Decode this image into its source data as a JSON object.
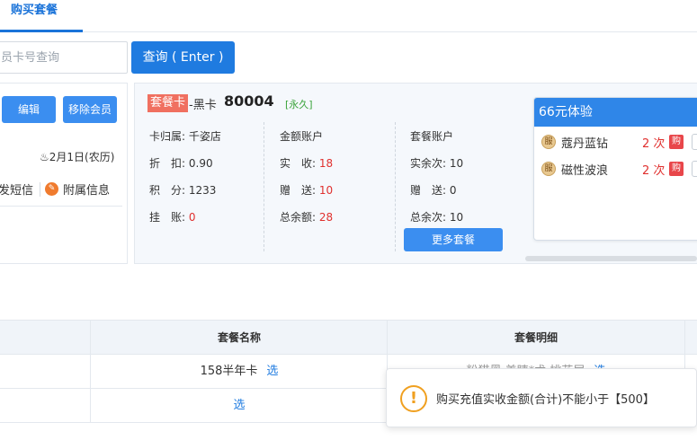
{
  "tabs": {
    "active_label": "购买套餐"
  },
  "search": {
    "placeholder": "员卡号查询",
    "button_label": "查询 ( Enter )"
  },
  "member": {
    "edit_label": "编辑",
    "remove_label": "移除会员",
    "date": "2月1日(农历)",
    "sms_label": "发短信",
    "attach_label": "附属信息"
  },
  "card": {
    "tag": "套餐卡",
    "type": "-黑卡",
    "number": "80004",
    "term": "[永久]",
    "col1": {
      "store_label": "卡归属:",
      "store_value": "千姿店",
      "discount_label": "折　扣:",
      "discount_value": "0.90",
      "points_label": "积　分:",
      "points_value": "1233",
      "credit_label": "挂　账:",
      "credit_value": "0"
    },
    "col2": {
      "title": "金额账户",
      "received_label": "实　收:",
      "received_value": "18",
      "gift_label": "赠　送:",
      "gift_value": "10",
      "balance_label": "总余额:",
      "balance_value": "28"
    },
    "col3": {
      "title": "套餐账户",
      "remaining_label": "实余次:",
      "remaining_value": "10",
      "gift_label": "赠　送:",
      "gift_value": "0",
      "total_label": "总余次:",
      "total_value": "10"
    },
    "more_label": "更多套餐"
  },
  "package_panel": {
    "title": "66元体验",
    "items": [
      {
        "icon": "服",
        "name": "蔻丹蓝钻",
        "count": "2 次",
        "buy": "购"
      },
      {
        "icon": "服",
        "name": "磁性波浪",
        "count": "2 次",
        "buy": "购"
      }
    ]
  },
  "table": {
    "headers": [
      "套餐名称",
      "套餐明细"
    ],
    "rows": [
      {
        "name": "158半年卡",
        "select": "选",
        "detail": "粉猫黑 美睫*术 桃花层",
        "detail_select": "选"
      },
      {
        "name": "",
        "select": "选",
        "detail": "",
        "detail_select": ""
      }
    ]
  },
  "toast": {
    "icon": "!",
    "message": "购买充值实收金额(合计)不能小于【500】"
  },
  "colors": {
    "accent": "#1f7be0",
    "danger": "#e0302e",
    "warning": "#f0a020",
    "success": "#3aa33a"
  }
}
